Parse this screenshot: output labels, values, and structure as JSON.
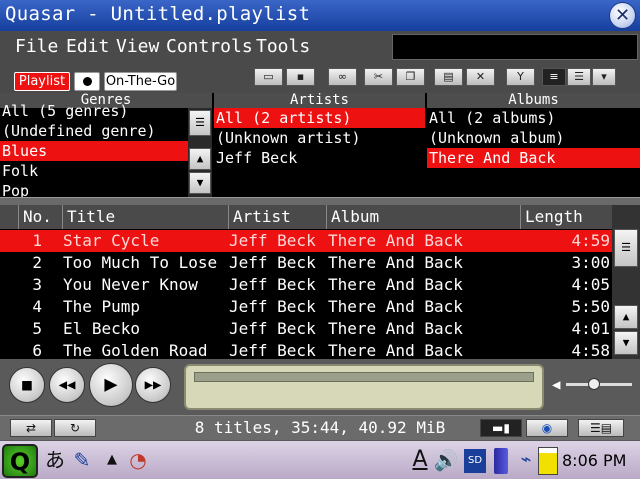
{
  "window": {
    "title": "Quasar - Untitled.playlist",
    "close": "✕"
  },
  "menu": {
    "file": "File",
    "edit": "Edit",
    "view": "View",
    "controls": "Controls",
    "tools": "Tools"
  },
  "tabs": {
    "playlist": "Playlist",
    "on_the_go": "On-The-Go"
  },
  "browser": {
    "genres": {
      "header": "Genres",
      "items": [
        "All (5 genres)",
        "(Undefined genre)",
        "Blues",
        "Folk",
        "Pop"
      ],
      "selected": 2
    },
    "artists": {
      "header": "Artists",
      "items": [
        "All (2 artists)",
        "(Unknown artist)",
        "Jeff Beck"
      ],
      "selected": 0
    },
    "albums": {
      "header": "Albums",
      "items": [
        "All (2 albums)",
        "(Unknown album)",
        "There And Back"
      ],
      "selected": 2
    }
  },
  "tracks": {
    "columns": {
      "no": "No.",
      "title": "Title",
      "artist": "Artist",
      "album": "Album",
      "length": "Length"
    },
    "rows": [
      {
        "no": "1",
        "title": "Star Cycle",
        "artist": "Jeff Beck",
        "album": "There And Back",
        "length": "4:59"
      },
      {
        "no": "2",
        "title": "Too Much To Lose",
        "artist": "Jeff Beck",
        "album": "There And Back",
        "length": "3:00"
      },
      {
        "no": "3",
        "title": "You Never Know",
        "artist": "Jeff Beck",
        "album": "There And Back",
        "length": "4:05"
      },
      {
        "no": "4",
        "title": "The Pump",
        "artist": "Jeff Beck",
        "album": "There And Back",
        "length": "5:50"
      },
      {
        "no": "5",
        "title": "El Becko",
        "artist": "Jeff Beck",
        "album": "There And Back",
        "length": "4:01"
      },
      {
        "no": "6",
        "title": "The Golden Road",
        "artist": "Jeff Beck",
        "album": "There And Back",
        "length": "4:58"
      }
    ],
    "selected": 0
  },
  "status": {
    "summary": "8 titles, 35:44, 40.92 MiB"
  },
  "taskbar": {
    "input_method": "あ",
    "keyboard_indicator": "A",
    "clock": "8:06 PM"
  },
  "colors": {
    "accent": "#ee1111",
    "titlebar": "#2a56b8",
    "panel_bg": "#000000",
    "toolbar_bg": "#4a4a4a"
  }
}
